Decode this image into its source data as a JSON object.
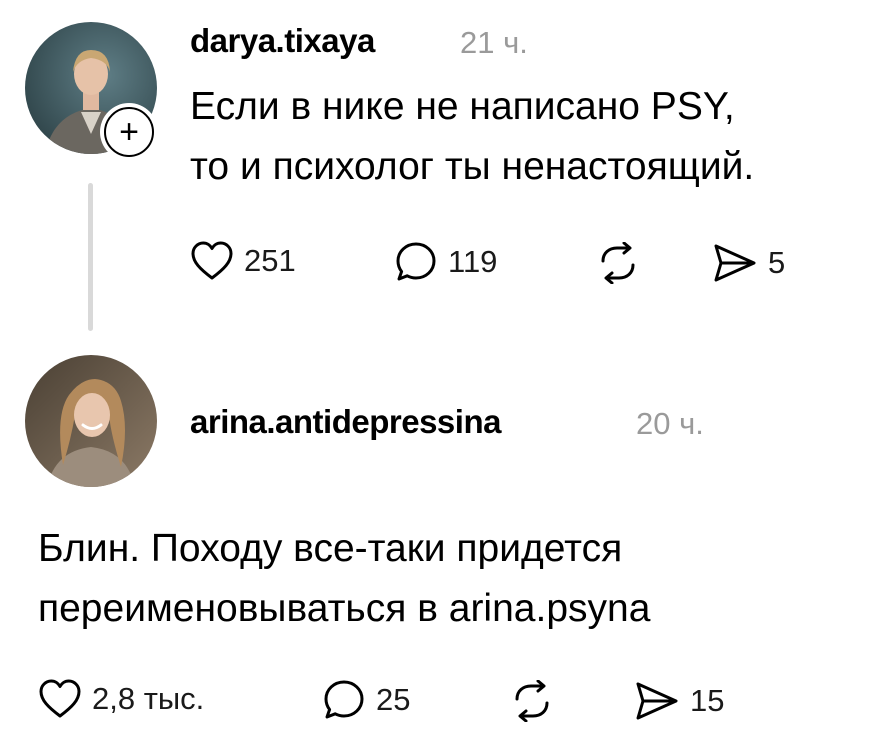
{
  "post": {
    "username": "darya.tixaya",
    "time": "21 ч.",
    "text_lines": [
      "Если в нике не написано PSY,",
      "то и психолог ты ненастоящий."
    ],
    "follow_symbol": "+",
    "likes": "251",
    "replies": "119",
    "shares": "5"
  },
  "reply": {
    "username": "arina.antidepressina",
    "time": "20 ч.",
    "text_lines": [
      "Блин. Походу все-таки придется",
      "переименовываться в arina.psyna"
    ],
    "likes": "2,8 тыс.",
    "replies": "25",
    "shares": "15"
  },
  "icons": [
    "heart-icon",
    "comment-icon",
    "repost-icon",
    "send-icon",
    "plus-icon"
  ],
  "colors": {
    "text": "#000000",
    "muted": "#9a9a9a",
    "thread_line": "#d9d9d9"
  }
}
